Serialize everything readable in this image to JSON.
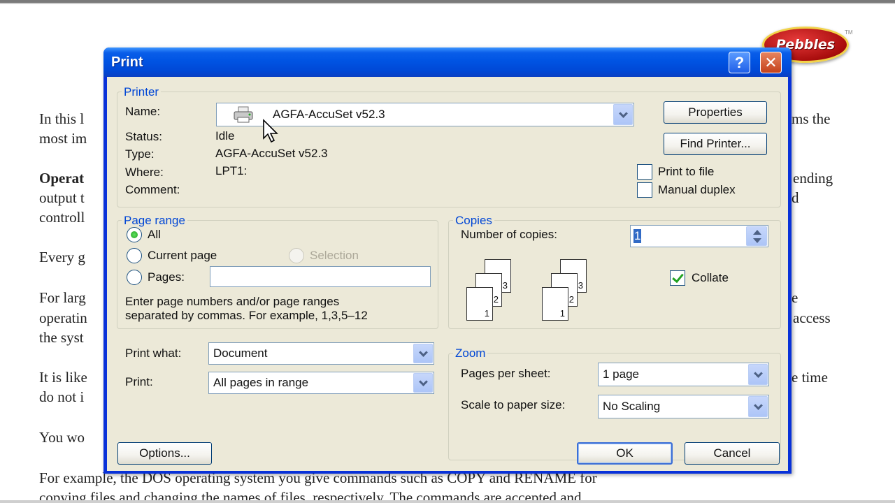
{
  "background_doc": {
    "lines": [
      "In this l",
      "most im",
      "Operat",
      "output t",
      "controll",
      "Every g",
      "For larg",
      "operatin",
      "the syst",
      "It is like",
      "do not i",
      "You wo",
      "For example, the DOS operating system you give commands such as COPY and RENAME for",
      "copying files and changing the names of files, respectively. The commands are accepted and"
    ],
    "right_fragments": [
      "ms the",
      "ending",
      "d",
      "access",
      "e time",
      "e"
    ]
  },
  "logo": {
    "text": "Pebbles",
    "tm": "TM"
  },
  "dialog": {
    "title": "Print",
    "help_icon": "question-mark-icon",
    "close_icon": "close-x-icon",
    "printer": {
      "group_label": "Printer",
      "name_label": "Name:",
      "name_value": "AGFA-AccuSet v52.3",
      "status_label": "Status:",
      "status_value": "Idle",
      "type_label": "Type:",
      "type_value": "AGFA-AccuSet v52.3",
      "where_label": "Where:",
      "where_value": "LPT1:",
      "comment_label": "Comment:",
      "properties_button": "Properties",
      "find_printer_button": "Find Printer...",
      "print_to_file": "Print to file",
      "manual_duplex": "Manual duplex"
    },
    "page_range": {
      "group_label": "Page range",
      "all": "All",
      "current_page": "Current page",
      "selection": "Selection",
      "pages": "Pages:",
      "pages_value": "",
      "hint_line1": "Enter page numbers and/or page ranges",
      "hint_line2": "separated by commas.  For example, 1,3,5–12"
    },
    "copies": {
      "group_label": "Copies",
      "number_label": "Number of copies:",
      "number_value": "1",
      "collate": "Collate",
      "page_numbers": [
        "1",
        "2",
        "3"
      ]
    },
    "print_what": {
      "label": "Print what:",
      "value": "Document"
    },
    "print": {
      "label": "Print:",
      "value": "All pages in range"
    },
    "zoom": {
      "group_label": "Zoom",
      "pages_per_sheet_label": "Pages per sheet:",
      "pages_per_sheet_value": "1 page",
      "scale_label": "Scale to paper size:",
      "scale_value": "No Scaling"
    },
    "options_button": "Options...",
    "ok_button": "OK",
    "cancel_button": "Cancel"
  }
}
